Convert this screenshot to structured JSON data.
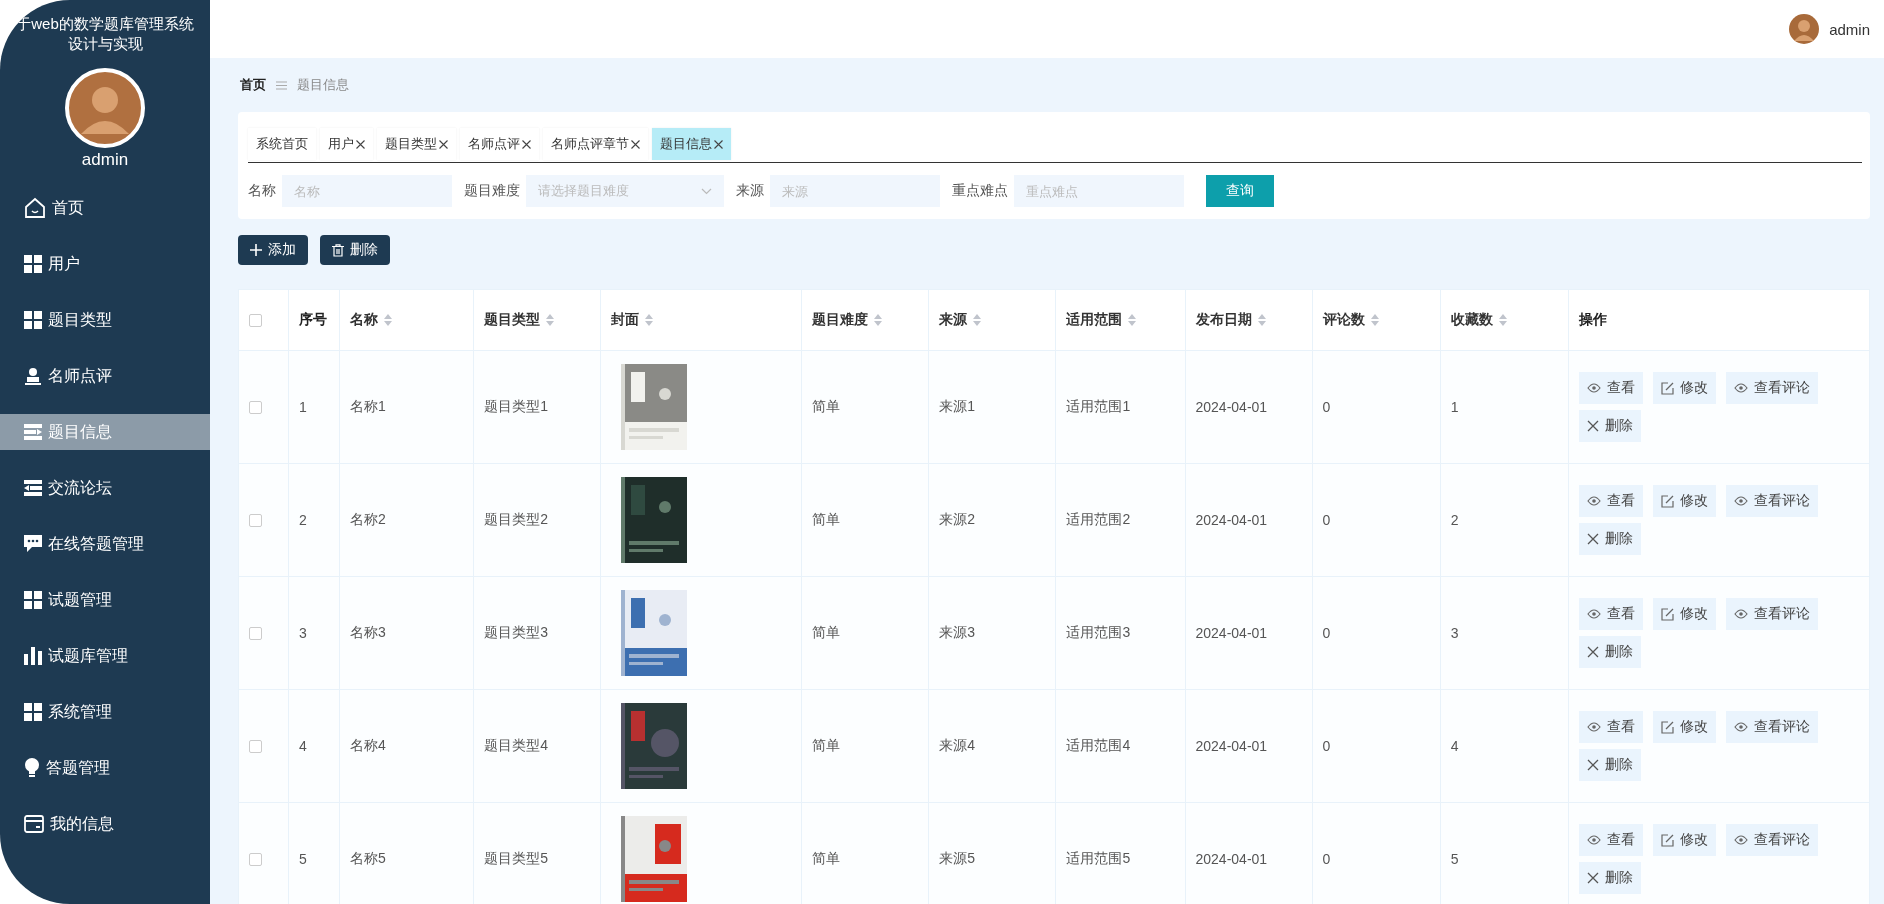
{
  "sidebar": {
    "title_lines": [
      "于web的数学题库管理系统",
      "设计与实现"
    ],
    "user": "admin",
    "items": [
      {
        "label": "首页",
        "selected": false
      },
      {
        "label": "用户",
        "selected": false
      },
      {
        "label": "题目类型",
        "selected": false
      },
      {
        "label": "名师点评",
        "selected": false
      },
      {
        "label": "题目信息",
        "selected": true
      },
      {
        "label": "交流论坛",
        "selected": false
      },
      {
        "label": "在线答题管理",
        "selected": false
      },
      {
        "label": "试题管理",
        "selected": false
      },
      {
        "label": "试题库管理",
        "selected": false
      },
      {
        "label": "系统管理",
        "selected": false
      },
      {
        "label": "答题管理",
        "selected": false
      },
      {
        "label": "我的信息",
        "selected": false
      }
    ]
  },
  "topbar": {
    "user": "admin"
  },
  "breadcrumb": [
    "首页",
    "题目信息"
  ],
  "tabs": [
    {
      "label": "系统首页",
      "closable": false,
      "selected": false
    },
    {
      "label": "用户",
      "closable": true,
      "selected": false
    },
    {
      "label": "题目类型",
      "closable": true,
      "selected": false
    },
    {
      "label": "名师点评",
      "closable": true,
      "selected": false
    },
    {
      "label": "名师点评章节",
      "closable": true,
      "selected": false
    },
    {
      "label": "题目信息",
      "closable": true,
      "selected": true
    }
  ],
  "search": {
    "fields": [
      {
        "label": "名称",
        "kind": "input",
        "placeholder": "名称"
      },
      {
        "label": "题目难度",
        "kind": "select",
        "placeholder": "请选择题目难度"
      },
      {
        "label": "来源",
        "kind": "input",
        "placeholder": "来源"
      },
      {
        "label": "重点难点",
        "kind": "input",
        "placeholder": "重点难点"
      }
    ],
    "button": "查询"
  },
  "toolbar": [
    {
      "label": "添加",
      "kind": "add"
    },
    {
      "label": "删除",
      "kind": "delete"
    }
  ],
  "table": {
    "all_checked": false,
    "columns": [
      {
        "label": "序号",
        "sortable": false
      },
      {
        "label": "名称",
        "sortable": true
      },
      {
        "label": "题目类型",
        "sortable": true
      },
      {
        "label": "封面",
        "sortable": true
      },
      {
        "label": "题目难度",
        "sortable": true
      },
      {
        "label": "来源",
        "sortable": true
      },
      {
        "label": "适用范围",
        "sortable": true
      },
      {
        "label": "发布日期",
        "sortable": true
      },
      {
        "label": "评论数",
        "sortable": true
      },
      {
        "label": "收藏数",
        "sortable": true
      },
      {
        "label": "操作",
        "sortable": false
      }
    ],
    "rows": [
      {
        "checked": false,
        "cells": [
          "1",
          "名称1",
          "题目类型1",
          {
            "kind": "picture"
          },
          "简单",
          "来源1",
          "适用范围1",
          "2024-04-01",
          "0",
          "1"
        ],
        "actions": [
          {
            "label": "查看",
            "kind": "view"
          },
          {
            "label": "修改",
            "kind": "edit"
          },
          {
            "label": "查看评论",
            "kind": "view"
          },
          {
            "label": "删除",
            "kind": "delete"
          }
        ]
      },
      {
        "checked": false,
        "cells": [
          "2",
          "名称2",
          "题目类型2",
          {
            "kind": "picture"
          },
          "简单",
          "来源2",
          "适用范围2",
          "2024-04-01",
          "0",
          "2"
        ],
        "actions": [
          {
            "label": "查看",
            "kind": "view"
          },
          {
            "label": "修改",
            "kind": "edit"
          },
          {
            "label": "查看评论",
            "kind": "view"
          },
          {
            "label": "删除",
            "kind": "delete"
          }
        ]
      },
      {
        "checked": false,
        "cells": [
          "3",
          "名称3",
          "题目类型3",
          {
            "kind": "picture"
          },
          "简单",
          "来源3",
          "适用范围3",
          "2024-04-01",
          "0",
          "3"
        ],
        "actions": [
          {
            "label": "查看",
            "kind": "view"
          },
          {
            "label": "修改",
            "kind": "edit"
          },
          {
            "label": "查看评论",
            "kind": "view"
          },
          {
            "label": "删除",
            "kind": "delete"
          }
        ]
      },
      {
        "checked": false,
        "cells": [
          "4",
          "名称4",
          "题目类型4",
          {
            "kind": "picture"
          },
          "简单",
          "来源4",
          "适用范围4",
          "2024-04-01",
          "0",
          "4"
        ],
        "actions": [
          {
            "label": "查看",
            "kind": "view"
          },
          {
            "label": "修改",
            "kind": "edit"
          },
          {
            "label": "查看评论",
            "kind": "view"
          },
          {
            "label": "删除",
            "kind": "delete"
          }
        ]
      },
      {
        "checked": false,
        "cells": [
          "5",
          "名称5",
          "题目类型5",
          {
            "kind": "picture"
          },
          "简单",
          "来源5",
          "适用范围5",
          "2024-04-01",
          "0",
          "5"
        ],
        "actions": [
          {
            "label": "查看",
            "kind": "view"
          },
          {
            "label": "修改",
            "kind": "edit"
          },
          {
            "label": "查看评论",
            "kind": "view"
          },
          {
            "label": "删除",
            "kind": "delete"
          }
        ]
      }
    ]
  }
}
